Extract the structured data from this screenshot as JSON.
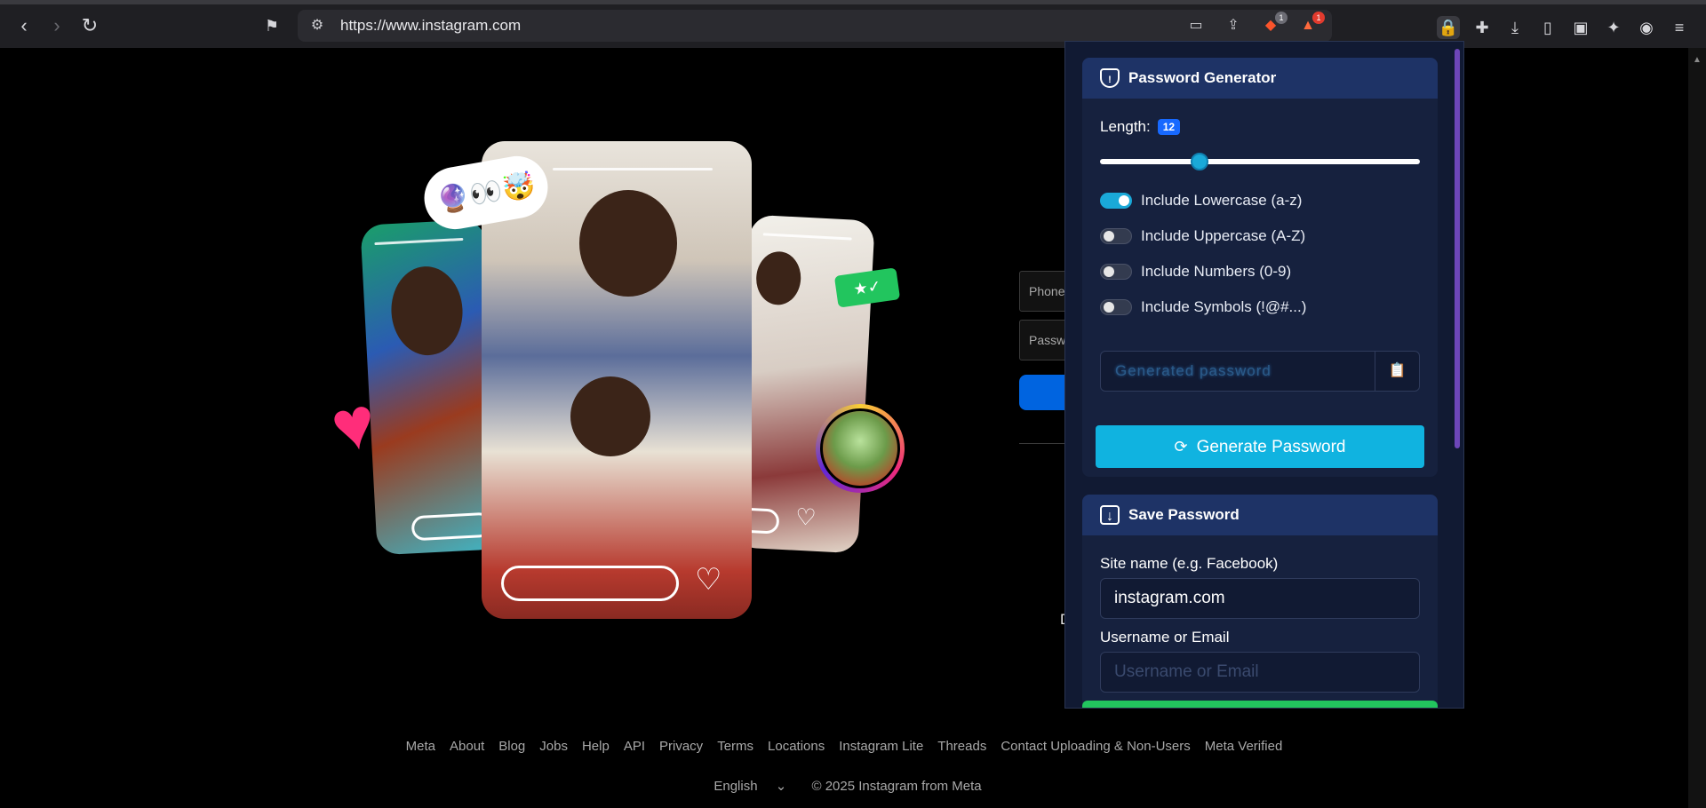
{
  "browser": {
    "url": "https://www.instagram.com",
    "badges": {
      "brave": "1",
      "rewards": "1"
    }
  },
  "login_stub": {
    "phone_placeholder": "Phone",
    "password_placeholder": "Passw",
    "stub_char": "D"
  },
  "footer": {
    "links": [
      "Meta",
      "About",
      "Blog",
      "Jobs",
      "Help",
      "API",
      "Privacy",
      "Terms",
      "Locations",
      "Instagram Lite",
      "Threads",
      "Contact Uploading & Non-Users",
      "Meta Verified"
    ],
    "language": "English",
    "copyright": "© 2025 Instagram from Meta"
  },
  "popup": {
    "generator": {
      "title": "Password Generator",
      "length_label": "Length:",
      "length_value": "12",
      "length_fraction": 0.3,
      "options": [
        {
          "label": "Include Lowercase (a-z)",
          "on": true
        },
        {
          "label": "Include Uppercase (A-Z)",
          "on": false
        },
        {
          "label": "Include Numbers (0-9)",
          "on": false
        },
        {
          "label": "Include Symbols (!@#...)",
          "on": false
        }
      ],
      "password_placeholder": "Generated password",
      "generate_label": "Generate Password"
    },
    "save": {
      "title": "Save Password",
      "site_label": "Site name (e.g. Facebook)",
      "site_value": "instagram.com",
      "user_label": "Username or Email",
      "user_placeholder": "Username or Email"
    }
  },
  "colors": {
    "accent": "#10b3e0",
    "header": "#1e3366",
    "save_button": "#22c55e"
  }
}
